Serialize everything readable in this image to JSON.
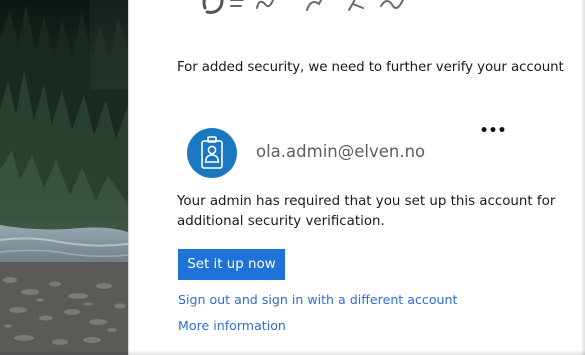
{
  "verify": {
    "headline": "For added security, we need to further verify your account",
    "account": {
      "email": "ola.admin@elven.no",
      "avatar_icon": "id-badge-icon",
      "avatar_color": "#1a78c2",
      "menu_icon": "more-options-icon",
      "menu_glyph": "•••"
    },
    "description": "Your admin has required that you set up this account for additional security verification.",
    "primary_button_label": "Set it up now",
    "primary_color": "#1d73d8",
    "signout_link": "Sign out and sign in with a different account",
    "more_info_link": "More information",
    "link_color": "#2e6ed4"
  }
}
